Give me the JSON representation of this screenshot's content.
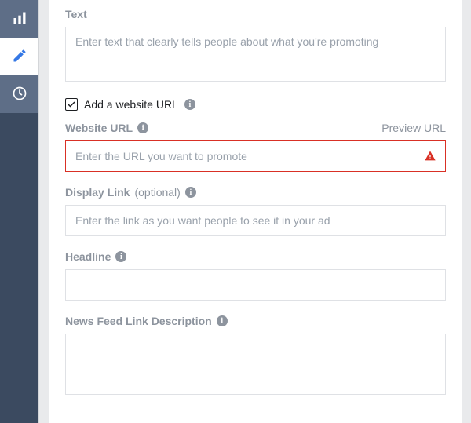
{
  "fields": {
    "text": {
      "label": "Text",
      "placeholder": "Enter text that clearly tells people about what you're promoting"
    },
    "add_url_checkbox": {
      "label": "Add a website URL",
      "checked": true
    },
    "website_url": {
      "label": "Website URL",
      "preview_label": "Preview URL",
      "placeholder": "Enter the URL you want to promote"
    },
    "display_link": {
      "label": "Display Link",
      "optional": "(optional)",
      "placeholder": "Enter the link as you want people to see it in your ad"
    },
    "headline": {
      "label": "Headline"
    },
    "news_feed_desc": {
      "label": "News Feed Link Description"
    }
  }
}
